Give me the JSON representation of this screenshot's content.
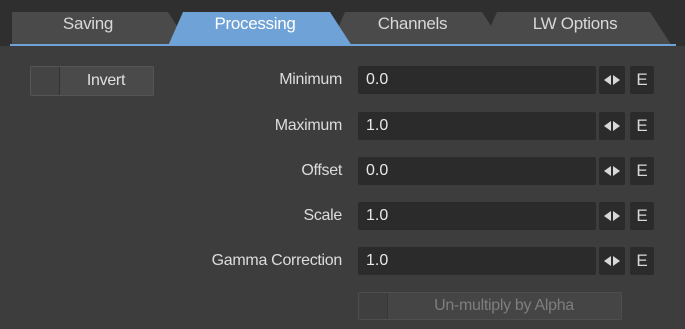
{
  "tabs": [
    {
      "label": "Saving",
      "active": false
    },
    {
      "label": "Processing",
      "active": true
    },
    {
      "label": "Channels",
      "active": false
    },
    {
      "label": "LW Options",
      "active": false
    }
  ],
  "invert_button": {
    "label": "Invert"
  },
  "rows": [
    {
      "label": "Minimum",
      "value": "0.0"
    },
    {
      "label": "Maximum",
      "value": "1.0"
    },
    {
      "label": "Offset",
      "value": "0.0"
    },
    {
      "label": "Scale",
      "value": "1.0"
    },
    {
      "label": "Gamma Correction",
      "value": "1.0"
    }
  ],
  "envelope_label": "E",
  "unmultiply_button": {
    "label": "Un-multiply by Alpha",
    "enabled": false
  },
  "colors": {
    "active_tab": "#6fa2d6",
    "inactive_tab": "#4a4a4a",
    "panel": "#3b3b3b",
    "field": "#2b2b2b"
  }
}
